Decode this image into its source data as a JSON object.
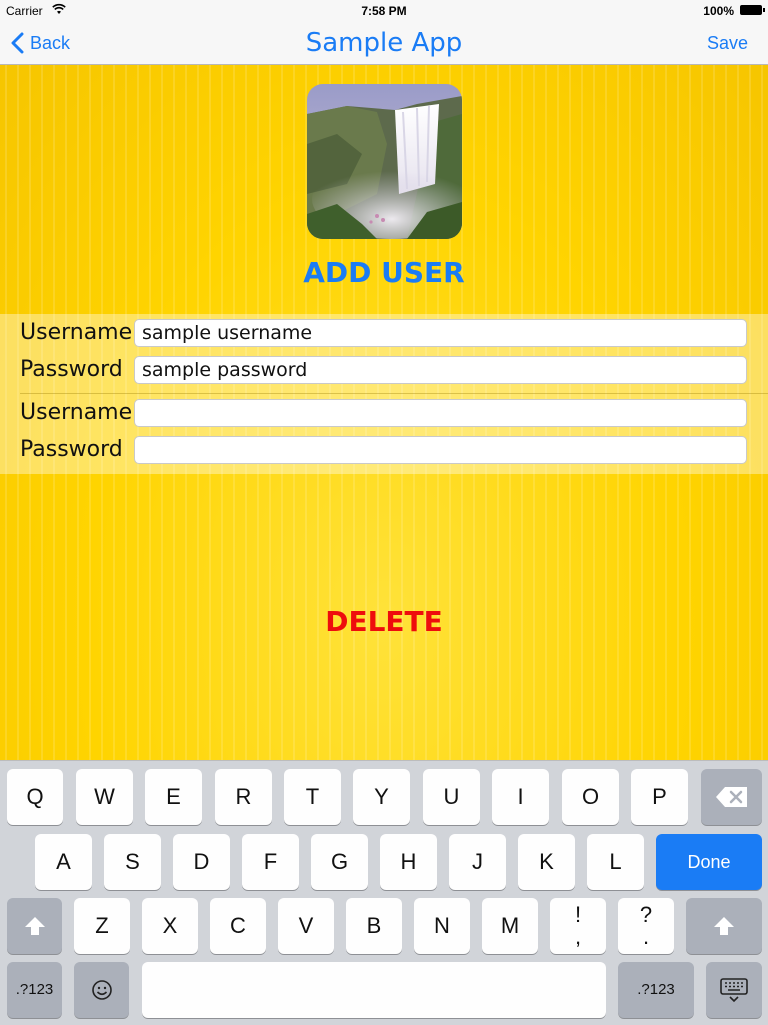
{
  "status_bar": {
    "carrier": "Carrier",
    "time": "7:58 PM",
    "battery": "100%"
  },
  "navbar": {
    "back_label": "Back",
    "title": "Sample App",
    "save_label": "Save"
  },
  "profile": {
    "add_user_label": "ADD USER"
  },
  "accounts": [
    {
      "username_label": "Username",
      "username_value": "sample username",
      "password_label": "Password",
      "password_value": "sample password"
    },
    {
      "username_label": "Username",
      "username_value": "",
      "password_label": "Password",
      "password_value": ""
    }
  ],
  "delete_label": "DELETE",
  "keyboard": {
    "row1": [
      "Q",
      "W",
      "E",
      "R",
      "T",
      "Y",
      "U",
      "I",
      "O",
      "P"
    ],
    "row2": [
      "A",
      "S",
      "D",
      "F",
      "G",
      "H",
      "J",
      "K",
      "L"
    ],
    "row3": [
      "Z",
      "X",
      "C",
      "V",
      "B",
      "N",
      "M"
    ],
    "exclaim_top": "!",
    "exclaim_bottom": ",",
    "question_top": "?",
    "question_bottom": ".",
    "done_label": "Done",
    "numbers_label": ".?123",
    "numbers_label_right": ".?123"
  },
  "colors": {
    "accent": "#1a7cf5",
    "delete": "#ee0d0d",
    "background": "#ffd400"
  }
}
